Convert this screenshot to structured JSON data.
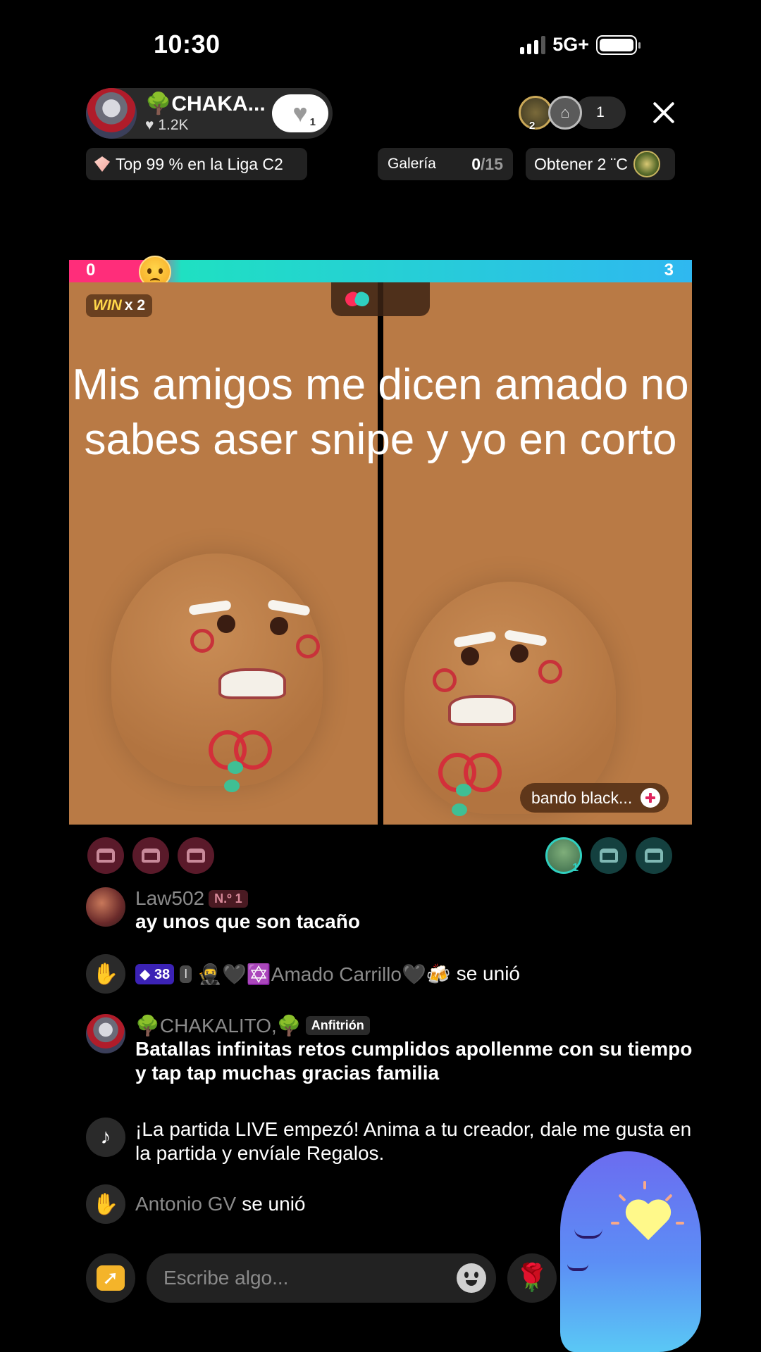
{
  "status_bar": {
    "time": "10:30",
    "network": "5G+"
  },
  "host": {
    "name": "🌳CHAKA...",
    "likes": "1.2K",
    "follow_count": "1"
  },
  "viewers": {
    "avatar_badge": "2",
    "count": "1"
  },
  "chips": {
    "league": "Top 99 % en la Liga C2",
    "gallery_label": "Galería",
    "gallery_current": "0",
    "gallery_total": "/15",
    "obtain": "Obtener 2 ¨C"
  },
  "battle": {
    "left_score": "0",
    "right_score": "3",
    "win_label": "WIN",
    "win_mult": "x 2",
    "left_color": "#ff2d7a",
    "right_color": "#2fb8f0"
  },
  "caption": "Mis amigos me dicen amado no sabes aser snipe y yo en corto",
  "guest_name": "bando black...",
  "seats": {
    "guest_avatar_badge": "1"
  },
  "chat": [
    {
      "user": "Law502",
      "rank": "N.º 1",
      "message": "ay unos que son tacaño"
    },
    {
      "level": "38",
      "shield": "I",
      "user": "🥷🖤✡️Amado Carrillo🖤🍻",
      "action": "se unió"
    },
    {
      "user": "🌳CHAKALITO,🌳",
      "role": "Anfitrión",
      "message": "Batallas infinitas retos cumplidos apollenme con su tiempo y tap tap muchas gracias familia"
    },
    {
      "message": "¡La partida LIVE empezó! Anima a tu creador, dale me gusta en la partida y envíale Regalos."
    },
    {
      "user": "Antonio GV",
      "action": "se unió"
    }
  ],
  "input": {
    "placeholder": "Escribe algo..."
  },
  "icons": {
    "wave": "✋",
    "tiktok": "♪",
    "rose": "🌹",
    "heart": "♥"
  }
}
